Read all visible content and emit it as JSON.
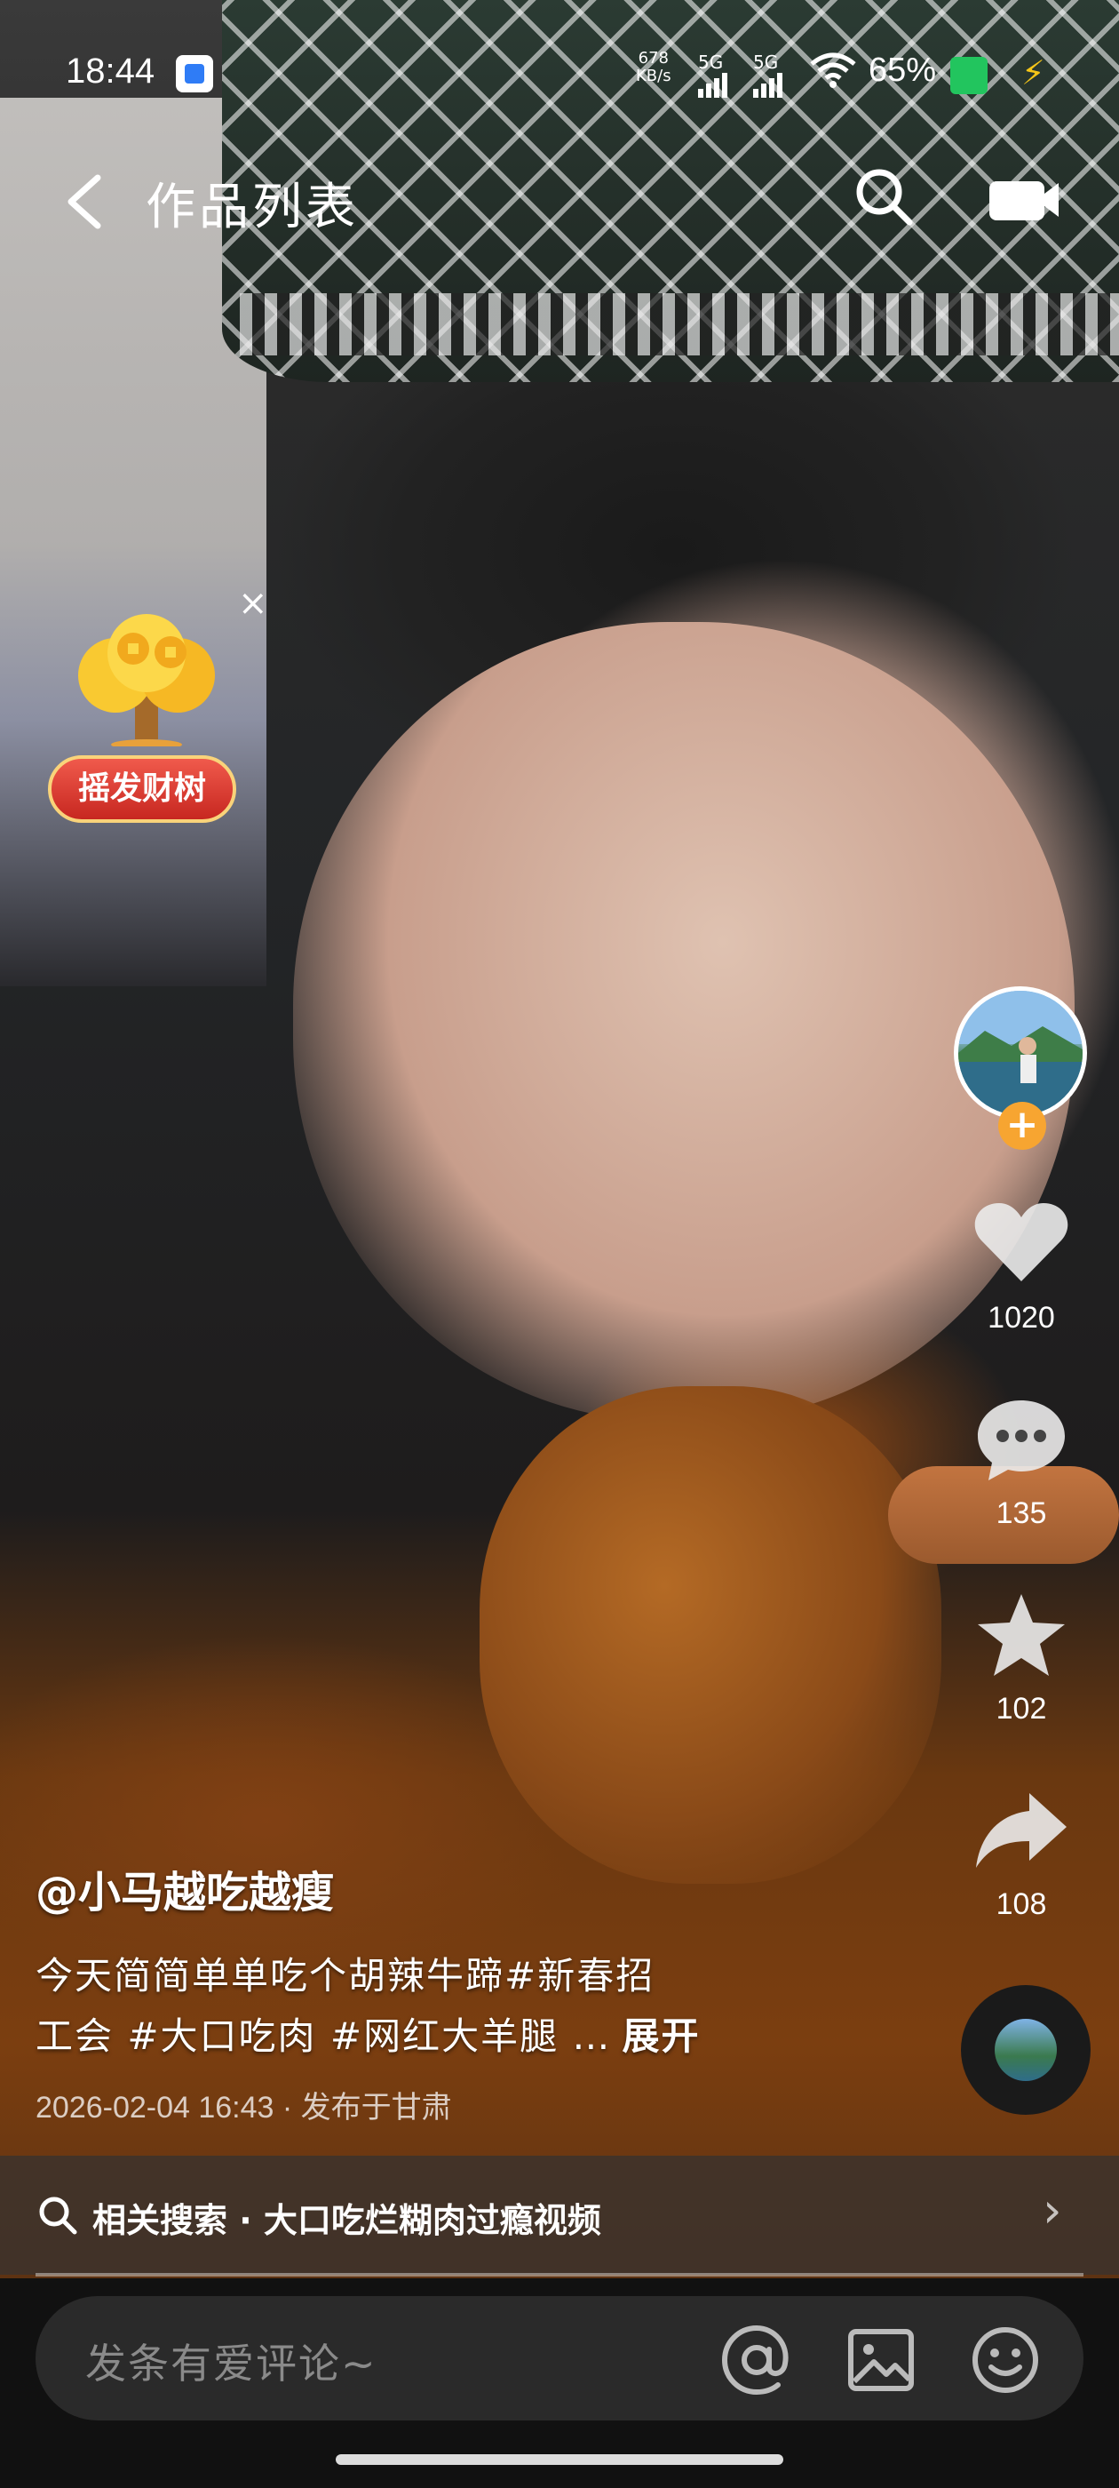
{
  "status_bar": {
    "time": "18:44",
    "net_speed_value": "678",
    "net_speed_unit": "KB/s",
    "sim1": "5G",
    "sim2": "5G",
    "battery_percent": "65%"
  },
  "nav": {
    "title": "作品列表"
  },
  "promo": {
    "label": "摇发财树"
  },
  "actions": {
    "like_count": "1020",
    "comment_count": "135",
    "favorite_count": "102",
    "share_count": "108"
  },
  "video": {
    "author": "@小马越吃越瘦",
    "desc_line1": "今天简简单单吃个胡辣牛蹄#新春招",
    "desc_line2": "工会 #大口吃肉 #网红大羊腿 …",
    "expand": "展开",
    "meta": "2026-02-04 16:43 · 发布于甘肃"
  },
  "related": {
    "text": "相关搜索 · 大口吃烂糊肉过瘾视频"
  },
  "comment": {
    "placeholder": "发条有爱评论~"
  },
  "colors": {
    "follow_badge": "#f7a531",
    "promo_red": "#d93a2f",
    "battery_green": "#22c55e"
  },
  "icons": [
    "back-icon",
    "search-icon",
    "camera-icon",
    "heart-icon",
    "comment-icon",
    "star-icon",
    "share-icon",
    "at-icon",
    "image-icon",
    "emoji-icon",
    "chevron-right-icon"
  ]
}
